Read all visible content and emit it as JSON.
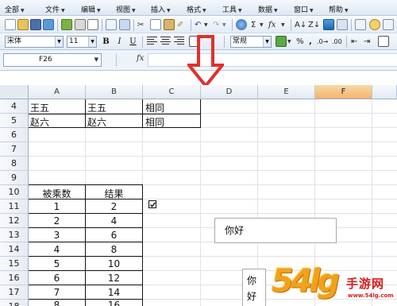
{
  "menu": [
    {
      "label": "全部"
    },
    {
      "label": "文件"
    },
    {
      "label": "编辑"
    },
    {
      "label": "视图"
    },
    {
      "label": "插入"
    },
    {
      "label": "格式"
    },
    {
      "label": "工具"
    },
    {
      "label": "数据"
    },
    {
      "label": "窗口"
    },
    {
      "label": "帮助"
    }
  ],
  "toolbar": {
    "font_name": "宋体",
    "font_size": "11",
    "bold": "B",
    "italic": "I",
    "underline": "U",
    "number_format": "常规",
    "percent": "%",
    "sum": "Σ",
    "fx": "fx",
    "comma": ","
  },
  "formula_bar": {
    "cell_ref": "F26",
    "fx_label": "fx",
    "content": ""
  },
  "columns": [
    "A",
    "B",
    "C",
    "D",
    "E",
    "F"
  ],
  "active_column": "F",
  "rows": [
    "4",
    "5",
    "6",
    "7",
    "8",
    "9",
    "10",
    "11",
    "12",
    "13",
    "14",
    "15",
    "16",
    "17",
    "18"
  ],
  "cells": {
    "a4": "王五",
    "b4": "王五",
    "c4": "相同",
    "a5": "赵六",
    "b5": "赵六",
    "c5": "相同",
    "a10": "被乘数",
    "b10": "结果"
  },
  "multiplication": [
    {
      "a": "1",
      "b": "2"
    },
    {
      "a": "2",
      "b": "4"
    },
    {
      "a": "3",
      "b": "6"
    },
    {
      "a": "4",
      "b": "8"
    },
    {
      "a": "5",
      "b": "10"
    },
    {
      "a": "6",
      "b": "12"
    },
    {
      "a": "7",
      "b": "14"
    },
    {
      "a": "8",
      "b": "16"
    }
  ],
  "checkbox_checked": true,
  "textbox1": "你好",
  "textbox2": [
    "你",
    "好"
  ],
  "watermark": {
    "logo": "54lg",
    "name": "手游网",
    "url": "www.54lg.com"
  },
  "colors": {
    "arrow_red": "#e0302a",
    "active_col": "#f3b26b",
    "watermark_orange": "#f0a21c",
    "watermark_red": "#d91a1a"
  }
}
